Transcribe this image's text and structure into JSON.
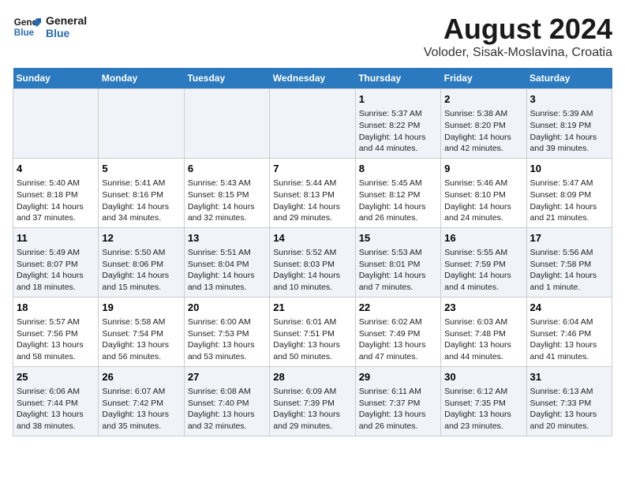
{
  "logo": {
    "line1": "General",
    "line2": "Blue"
  },
  "title": "August 2024",
  "subtitle": "Voloder, Sisak-Moslavina, Croatia",
  "days_header": [
    "Sunday",
    "Monday",
    "Tuesday",
    "Wednesday",
    "Thursday",
    "Friday",
    "Saturday"
  ],
  "weeks": [
    [
      {
        "num": "",
        "info": ""
      },
      {
        "num": "",
        "info": ""
      },
      {
        "num": "",
        "info": ""
      },
      {
        "num": "",
        "info": ""
      },
      {
        "num": "1",
        "info": "Sunrise: 5:37 AM\nSunset: 8:22 PM\nDaylight: 14 hours and 44 minutes."
      },
      {
        "num": "2",
        "info": "Sunrise: 5:38 AM\nSunset: 8:20 PM\nDaylight: 14 hours and 42 minutes."
      },
      {
        "num": "3",
        "info": "Sunrise: 5:39 AM\nSunset: 8:19 PM\nDaylight: 14 hours and 39 minutes."
      }
    ],
    [
      {
        "num": "4",
        "info": "Sunrise: 5:40 AM\nSunset: 8:18 PM\nDaylight: 14 hours and 37 minutes."
      },
      {
        "num": "5",
        "info": "Sunrise: 5:41 AM\nSunset: 8:16 PM\nDaylight: 14 hours and 34 minutes."
      },
      {
        "num": "6",
        "info": "Sunrise: 5:43 AM\nSunset: 8:15 PM\nDaylight: 14 hours and 32 minutes."
      },
      {
        "num": "7",
        "info": "Sunrise: 5:44 AM\nSunset: 8:13 PM\nDaylight: 14 hours and 29 minutes."
      },
      {
        "num": "8",
        "info": "Sunrise: 5:45 AM\nSunset: 8:12 PM\nDaylight: 14 hours and 26 minutes."
      },
      {
        "num": "9",
        "info": "Sunrise: 5:46 AM\nSunset: 8:10 PM\nDaylight: 14 hours and 24 minutes."
      },
      {
        "num": "10",
        "info": "Sunrise: 5:47 AM\nSunset: 8:09 PM\nDaylight: 14 hours and 21 minutes."
      }
    ],
    [
      {
        "num": "11",
        "info": "Sunrise: 5:49 AM\nSunset: 8:07 PM\nDaylight: 14 hours and 18 minutes."
      },
      {
        "num": "12",
        "info": "Sunrise: 5:50 AM\nSunset: 8:06 PM\nDaylight: 14 hours and 15 minutes."
      },
      {
        "num": "13",
        "info": "Sunrise: 5:51 AM\nSunset: 8:04 PM\nDaylight: 14 hours and 13 minutes."
      },
      {
        "num": "14",
        "info": "Sunrise: 5:52 AM\nSunset: 8:03 PM\nDaylight: 14 hours and 10 minutes."
      },
      {
        "num": "15",
        "info": "Sunrise: 5:53 AM\nSunset: 8:01 PM\nDaylight: 14 hours and 7 minutes."
      },
      {
        "num": "16",
        "info": "Sunrise: 5:55 AM\nSunset: 7:59 PM\nDaylight: 14 hours and 4 minutes."
      },
      {
        "num": "17",
        "info": "Sunrise: 5:56 AM\nSunset: 7:58 PM\nDaylight: 14 hours and 1 minute."
      }
    ],
    [
      {
        "num": "18",
        "info": "Sunrise: 5:57 AM\nSunset: 7:56 PM\nDaylight: 13 hours and 58 minutes."
      },
      {
        "num": "19",
        "info": "Sunrise: 5:58 AM\nSunset: 7:54 PM\nDaylight: 13 hours and 56 minutes."
      },
      {
        "num": "20",
        "info": "Sunrise: 6:00 AM\nSunset: 7:53 PM\nDaylight: 13 hours and 53 minutes."
      },
      {
        "num": "21",
        "info": "Sunrise: 6:01 AM\nSunset: 7:51 PM\nDaylight: 13 hours and 50 minutes."
      },
      {
        "num": "22",
        "info": "Sunrise: 6:02 AM\nSunset: 7:49 PM\nDaylight: 13 hours and 47 minutes."
      },
      {
        "num": "23",
        "info": "Sunrise: 6:03 AM\nSunset: 7:48 PM\nDaylight: 13 hours and 44 minutes."
      },
      {
        "num": "24",
        "info": "Sunrise: 6:04 AM\nSunset: 7:46 PM\nDaylight: 13 hours and 41 minutes."
      }
    ],
    [
      {
        "num": "25",
        "info": "Sunrise: 6:06 AM\nSunset: 7:44 PM\nDaylight: 13 hours and 38 minutes."
      },
      {
        "num": "26",
        "info": "Sunrise: 6:07 AM\nSunset: 7:42 PM\nDaylight: 13 hours and 35 minutes."
      },
      {
        "num": "27",
        "info": "Sunrise: 6:08 AM\nSunset: 7:40 PM\nDaylight: 13 hours and 32 minutes."
      },
      {
        "num": "28",
        "info": "Sunrise: 6:09 AM\nSunset: 7:39 PM\nDaylight: 13 hours and 29 minutes."
      },
      {
        "num": "29",
        "info": "Sunrise: 6:11 AM\nSunset: 7:37 PM\nDaylight: 13 hours and 26 minutes."
      },
      {
        "num": "30",
        "info": "Sunrise: 6:12 AM\nSunset: 7:35 PM\nDaylight: 13 hours and 23 minutes."
      },
      {
        "num": "31",
        "info": "Sunrise: 6:13 AM\nSunset: 7:33 PM\nDaylight: 13 hours and 20 minutes."
      }
    ]
  ]
}
